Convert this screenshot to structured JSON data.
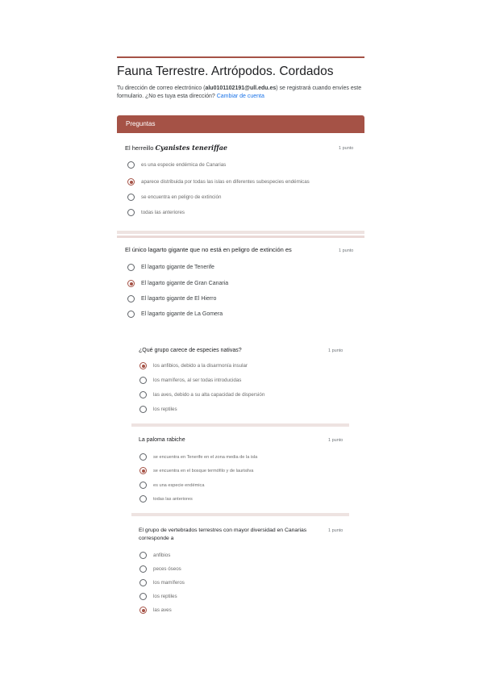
{
  "form": {
    "title": "Fauna Terrestre. Artrópodos. Cordados",
    "email_prefix": "Tu dirección de correo electrónico (",
    "email": "alu0101102191@ull.edu.es",
    "email_suffix": ") se registrará cuando envíes este formulario. ¿No es tuya esta dirección?",
    "switch_account": "Cambiar de cuenta",
    "accent_color": "#a55246"
  },
  "section": {
    "label": "Preguntas"
  },
  "questions": [
    {
      "text": "El herreillo ",
      "text_italic": "Cyanistes teneriffae",
      "points": "1 punto",
      "options": [
        "es una especie endémica de Canarias",
        "aparece distribuida por todas las islas en diferentes subespecies endémicas",
        "se encuentra en peligro de extinción",
        "todas las anteriores"
      ],
      "selected": 1
    },
    {
      "text": "El único lagarto gigante que no está en peligro de extinción es",
      "points": "1 punto",
      "options": [
        "El lagarto gigante de Tenerife",
        "El lagarto gigante de Gran Canaria",
        "El lagarto gigante de El Hierro",
        "El lagarto gigante de La Gomera"
      ],
      "selected": 1
    },
    {
      "text": "¿Qué grupo carece de especies nativas?",
      "points": "1 punto",
      "options": [
        "los anfibios, debido a la disarmonía insular",
        "los mamíferos, al ser todas introducidas",
        "las aves, debido a su alta capacidad de dispersión",
        "los reptiles"
      ],
      "selected": 0
    },
    {
      "text": "La paloma rabiche",
      "points": "1 punto",
      "options": [
        "se encuentra en Tenerife en el zona media de la isla",
        "se encuentra en el bosque termófilo y de laurisilva",
        "es una especie endémica",
        "todas las anteriores"
      ],
      "selected": 1
    },
    {
      "text": "El grupo de vertebrados terrestres con mayor diversidad en Canarias corresponde a",
      "points": "1 punto",
      "options": [
        "anfibios",
        "peces óseos",
        "los mamíferos",
        "los reptiles",
        "las aves"
      ],
      "selected": 4
    }
  ]
}
